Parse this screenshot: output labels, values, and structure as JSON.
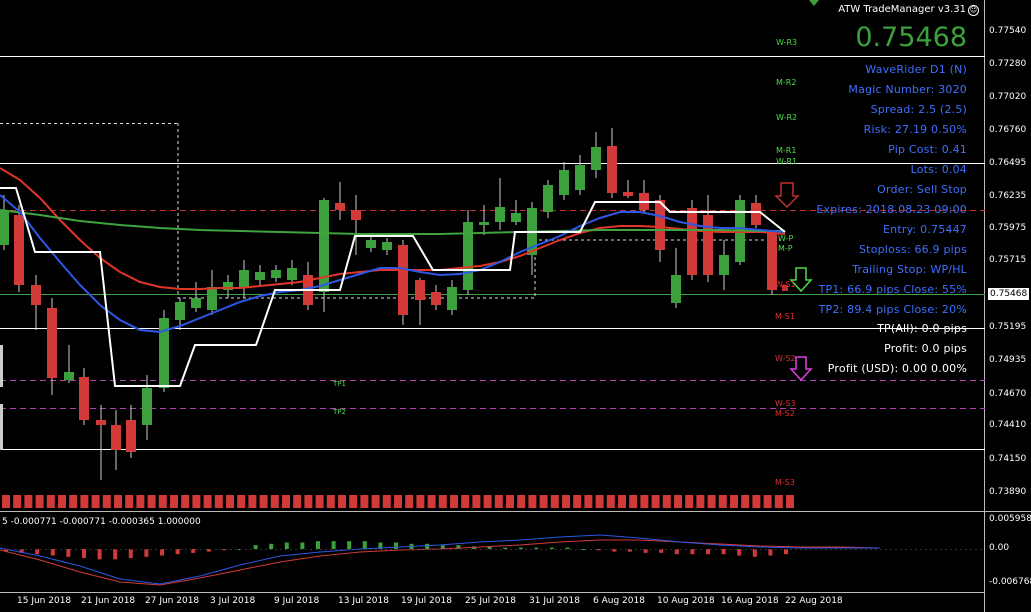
{
  "window": {
    "app_title": "ATW TradeManager v3.31",
    "current_price": "0.75468",
    "price_tag": "0.75468"
  },
  "info_panel": [
    {
      "text": "WaveRider D1 (N)",
      "color": "#3f6fff"
    },
    {
      "text": "Magic Number: 3020",
      "color": "#3f6fff"
    },
    {
      "text": "Spread: 2.5 (2.5)",
      "color": "#3f6fff"
    },
    {
      "text": "Risk: 27.19 0.50%",
      "color": "#3f6fff"
    },
    {
      "text": "Pip Cost: 0.41",
      "color": "#3f6fff"
    },
    {
      "text": "Lots: 0.04",
      "color": "#3f6fff"
    },
    {
      "text": "Order: Sell Stop",
      "color": "#3f6fff"
    },
    {
      "text": "Expires: 2018.08.23 09:00",
      "color": "#3f6fff"
    },
    {
      "text": "Entry: 0.75447",
      "color": "#3f6fff"
    },
    {
      "text": "Stoploss: 66.9 pips",
      "color": "#3f6fff"
    },
    {
      "text": "Trailing Stop: WP/HL",
      "color": "#3f6fff"
    },
    {
      "text": "TP1: 66.9 pips Close: 55%",
      "color": "#3f6fff"
    },
    {
      "text": "TP2: 89.4 pips Close: 20%",
      "color": "#3f6fff"
    },
    {
      "text": "TP(All): 0.0 pips",
      "color": "#ffffff"
    },
    {
      "text": "Profit: 0.0 pips",
      "color": "#ffffff"
    },
    {
      "text": "Profit (USD): 0.00 0.00%",
      "color": "#ffffff"
    }
  ],
  "y_axis": [
    "0.77540",
    "0.77280",
    "0.77020",
    "0.76760",
    "0.76495",
    "0.76235",
    "0.75975",
    "0.75715",
    "0.75195",
    "0.74935",
    "0.74670",
    "0.74410",
    "0.74150",
    "0.73890"
  ],
  "x_axis": [
    "15 Jun 2018",
    "21 Jun 2018",
    "27 Jun 2018",
    "3 Jul 2018",
    "9 Jul 2018",
    "13 Jul 2018",
    "19 Jul 2018",
    "25 Jul 2018",
    "31 Jul 2018",
    "6 Aug 2018",
    "10 Aug 2018",
    "16 Aug 2018",
    "22 Aug 2018"
  ],
  "level_labels": [
    {
      "text": "W-R3",
      "color": "#4cdc4c"
    },
    {
      "text": "M-R2",
      "color": "#4cdc4c"
    },
    {
      "text": "W-R2",
      "color": "#4cdc4c"
    },
    {
      "text": "M-R1",
      "color": "#4cdc4c"
    },
    {
      "text": "W-R1",
      "color": "#4cdc4c"
    },
    {
      "text": "W-P",
      "color": "#4cdc4c"
    },
    {
      "text": "M-P",
      "color": "#4cdc4c"
    },
    {
      "text": "W-S1",
      "color": "#e03030"
    },
    {
      "text": "M-S1",
      "color": "#e03030"
    },
    {
      "text": "W-S2",
      "color": "#e03030"
    },
    {
      "text": "W-S3",
      "color": "#e03030"
    },
    {
      "text": "M-S2",
      "color": "#e03030"
    },
    {
      "text": "M-S3",
      "color": "#e03030"
    }
  ],
  "tp_labels": [
    "TP1",
    "TP2"
  ],
  "indicator": {
    "header": "5 -0.000771 -0.000771 -0.000365 1.000000",
    "axis": [
      "0.005958",
      "0.00",
      "-0.006768"
    ]
  },
  "colors": {
    "bull": "#3ca13c",
    "bear": "#d23a3a",
    "ma_red": "#e0362a",
    "ma_blue": "#2f57e6",
    "ma_green": "#3fa33f",
    "stair": "#ffffff"
  }
}
